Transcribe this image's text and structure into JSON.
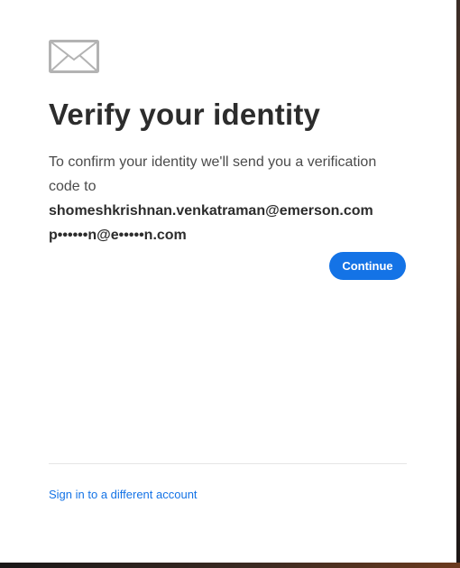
{
  "card": {
    "icon": "envelope-icon",
    "title": "Verify your identity",
    "description_prefix": "To confirm your identity we'll send you a verification code to",
    "email_primary": "shomeshkrishnan.venkatraman@emerson.com",
    "email_secondary": "p••••••n@e•••••n.com",
    "continue_label": "Continue",
    "alt_account_link": "Sign in to a different account"
  },
  "colors": {
    "accent": "#1473e6",
    "title_text": "#2c2c2c",
    "body_text": "#4b4b4b",
    "card_background": "#ffffff"
  }
}
